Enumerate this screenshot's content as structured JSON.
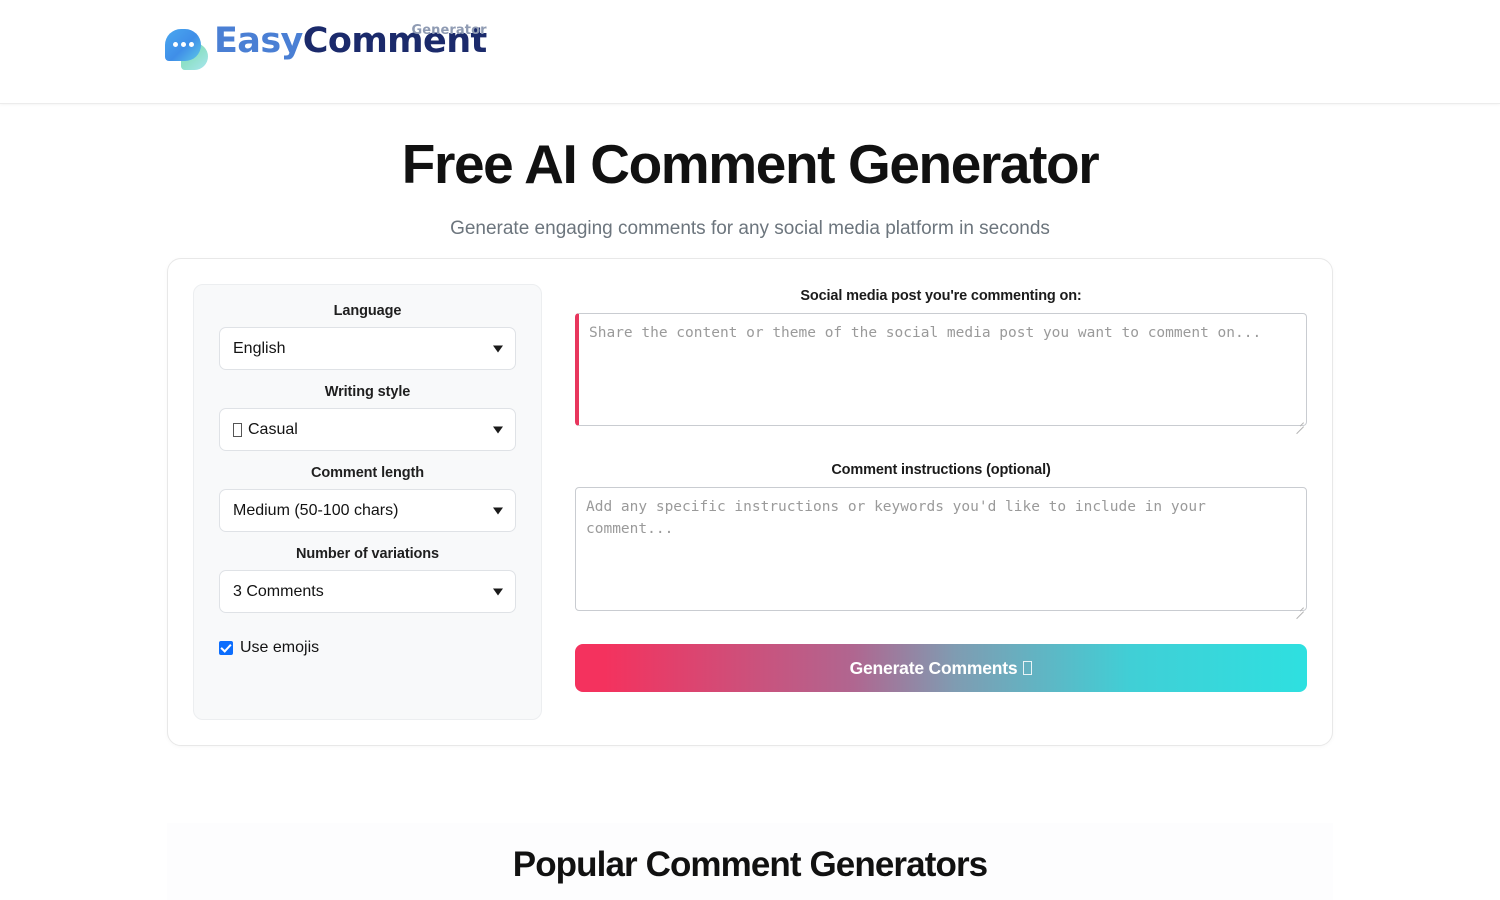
{
  "header": {
    "logo": {
      "icon": "speech-bubble-icon",
      "word_primary": "Easy",
      "word_secondary": "Comment",
      "superscript": "Generator"
    }
  },
  "hero": {
    "title": "Free AI Comment Generator",
    "subtitle": "Generate engaging comments for any social media platform in seconds"
  },
  "options": {
    "language": {
      "label": "Language",
      "value": "English",
      "arrow_icon": "chevron-down-icon"
    },
    "writing_style": {
      "label": "Writing style",
      "value": "Casual",
      "value_prefix_glyph": "missing-emoji-glyph",
      "arrow_icon": "chevron-down-icon"
    },
    "comment_length": {
      "label": "Comment length",
      "value": "Medium (50-100 chars)",
      "arrow_icon": "chevron-down-icon"
    },
    "variations": {
      "label": "Number of variations",
      "value": "3 Comments",
      "arrow_icon": "chevron-down-icon"
    },
    "use_emojis": {
      "label": "Use emojis",
      "checked": true,
      "accent_color": "#0d6efd"
    }
  },
  "form": {
    "post": {
      "label": "Social media post you're commenting on:",
      "placeholder": "Share the content or theme of the social media post you want to comment on...",
      "value": "",
      "required_marker_color": "#e8365d"
    },
    "instructions": {
      "label": "Comment instructions (optional)",
      "placeholder": "Add any specific instructions or keywords you'd like to include in your comment...",
      "value": ""
    },
    "generate_button": {
      "label": "Generate Comments",
      "trailing_glyph": "missing-emoji-glyph",
      "gradient_start": "#f4325e",
      "gradient_end": "#2ee0e0"
    }
  },
  "popular": {
    "title": "Popular Comment Generators"
  }
}
